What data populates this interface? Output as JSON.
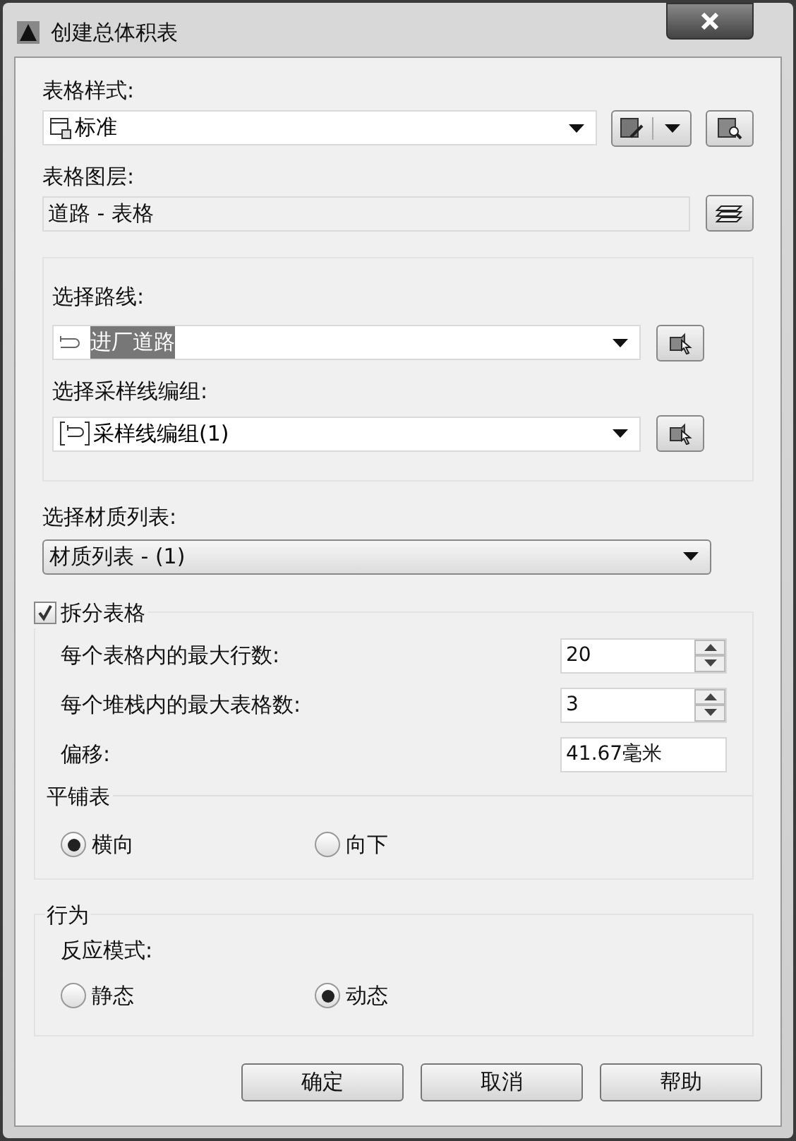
{
  "window": {
    "title": "创建总体积表"
  },
  "table_style": {
    "label": "表格样式:",
    "value": "标准"
  },
  "table_layer": {
    "label": "表格图层:",
    "value": "道路 - 表格"
  },
  "selection_group": {
    "alignment": {
      "label": "选择路线:",
      "value": "进厂道路",
      "highlighted": true
    },
    "sample_line_group": {
      "label": "选择采样线编组:",
      "value": "采样线编组(1)",
      "highlighted": false
    }
  },
  "material_list": {
    "label": "选择材质列表:",
    "value": "材质列表 - (1)"
  },
  "split_table": {
    "label": "拆分表格",
    "checked": true,
    "fields": [
      {
        "label": "每个表格内的最大行数:",
        "value": "20",
        "kind": "spinner"
      },
      {
        "label": "每个堆栈内的最大表格数:",
        "value": "3",
        "kind": "spinner"
      },
      {
        "label": "偏移:",
        "value": "41.67毫米",
        "kind": "text"
      }
    ],
    "tiling": {
      "title": "平铺表",
      "options": [
        {
          "label": "横向",
          "selected": true
        },
        {
          "label": "向下",
          "selected": false
        }
      ]
    }
  },
  "behavior": {
    "title": "行为",
    "label": "反应模式:",
    "options": [
      {
        "label": "静态",
        "selected": false
      },
      {
        "label": "动态",
        "selected": true
      }
    ]
  },
  "buttons": [
    "确定",
    "取消",
    "帮助"
  ]
}
